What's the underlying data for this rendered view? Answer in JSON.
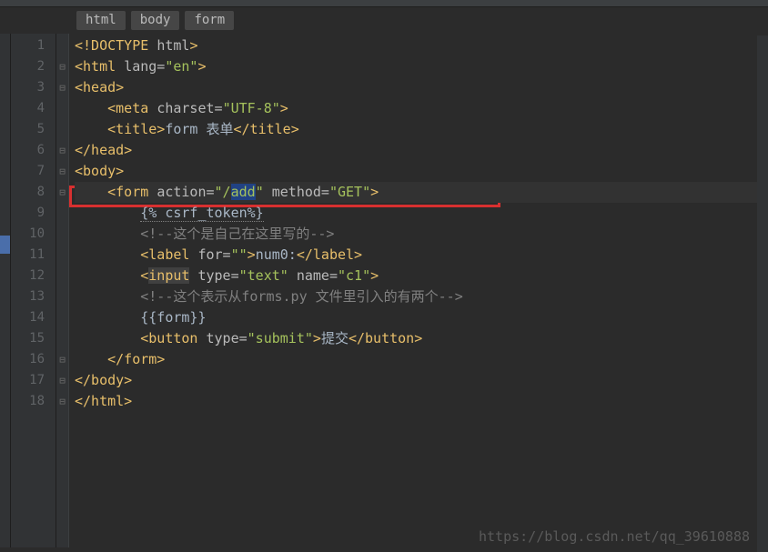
{
  "breadcrumbs": [
    "html",
    "body",
    "form"
  ],
  "lines": [
    {
      "n": "1",
      "fold": "",
      "html": "<span class='t-tag'>&lt;!DOCTYPE </span><span class='t-attr'>html</span><span class='t-tag'>&gt;</span>"
    },
    {
      "n": "2",
      "fold": "⊟",
      "html": "<span class='t-tag'>&lt;html </span><span class='t-attr'>lang=</span><span class='t-str'>\"en\"</span><span class='t-tag'>&gt;</span>"
    },
    {
      "n": "3",
      "fold": "⊟",
      "html": "<span class='t-tag'>&lt;head&gt;</span>"
    },
    {
      "n": "4",
      "fold": "",
      "html": "    <span class='t-tag'>&lt;meta </span><span class='t-attr'>charset=</span><span class='t-str'>\"UTF-8\"</span><span class='t-tag'>&gt;</span>"
    },
    {
      "n": "5",
      "fold": "",
      "html": "    <span class='t-tag'>&lt;title&gt;</span><span class='t-text'>form 表单</span><span class='t-tag'>&lt;/title&gt;</span>"
    },
    {
      "n": "6",
      "fold": "⊟",
      "html": "<span class='t-tag'>&lt;/head&gt;</span>"
    },
    {
      "n": "7",
      "fold": "⊟",
      "html": "<span class='t-tag'>&lt;body&gt;</span>"
    },
    {
      "n": "8",
      "fold": "⊟",
      "html": "    <span class='t-tag'>&lt;form </span><span class='t-attr'>action=</span><span class='t-str'>\"/<span class='t-sel'>add</span>\"</span><span class='t-attr'> method=</span><span class='t-str'>\"GET\"</span><span class='t-tag'>&gt;</span>",
      "current": true
    },
    {
      "n": "9",
      "fold": "",
      "html": "        <span class='t-text underlined'>{% csrf_token%}</span>"
    },
    {
      "n": "10",
      "fold": "",
      "html": "        <span class='t-cmt'>&lt;!--这个是自己在这里写的--&gt;</span>"
    },
    {
      "n": "11",
      "fold": "",
      "html": "        <span class='t-tag'>&lt;label </span><span class='t-attr'>for=</span><span class='t-str'>\"\"</span><span class='t-tag'>&gt;</span><span class='t-text'>num0:</span><span class='t-tag'>&lt;/label&gt;</span>"
    },
    {
      "n": "12",
      "fold": "",
      "html": "        <span class='t-tag'>&lt;<span style='background:#404040'>input</span> </span><span class='t-attr'>type=</span><span class='t-str'>\"text\"</span><span class='t-attr'> name=</span><span class='t-str'>\"c1\"</span><span class='t-tag'>&gt;</span>"
    },
    {
      "n": "13",
      "fold": "",
      "html": "        <span class='t-cmt'>&lt;!--这个表示从forms.py 文件里引入的有两个--&gt;</span>"
    },
    {
      "n": "14",
      "fold": "",
      "html": "        <span class='t-text'>{{form}}</span>"
    },
    {
      "n": "15",
      "fold": "",
      "html": "        <span class='t-tag'>&lt;button </span><span class='t-attr'>type=</span><span class='t-str'>\"submit\"</span><span class='t-tag'>&gt;</span><span class='t-text'>提交</span><span class='t-tag'>&lt;/button&gt;</span>"
    },
    {
      "n": "16",
      "fold": "⊟",
      "html": "    <span class='t-tag'>&lt;/form&gt;</span>"
    },
    {
      "n": "17",
      "fold": "⊟",
      "html": "<span class='t-tag'>&lt;/body&gt;</span>"
    },
    {
      "n": "18",
      "fold": "⊟",
      "html": "<span class='t-tag'>&lt;/html&gt;</span>"
    }
  ],
  "watermark": "https://blog.csdn.net/qq_39610888"
}
